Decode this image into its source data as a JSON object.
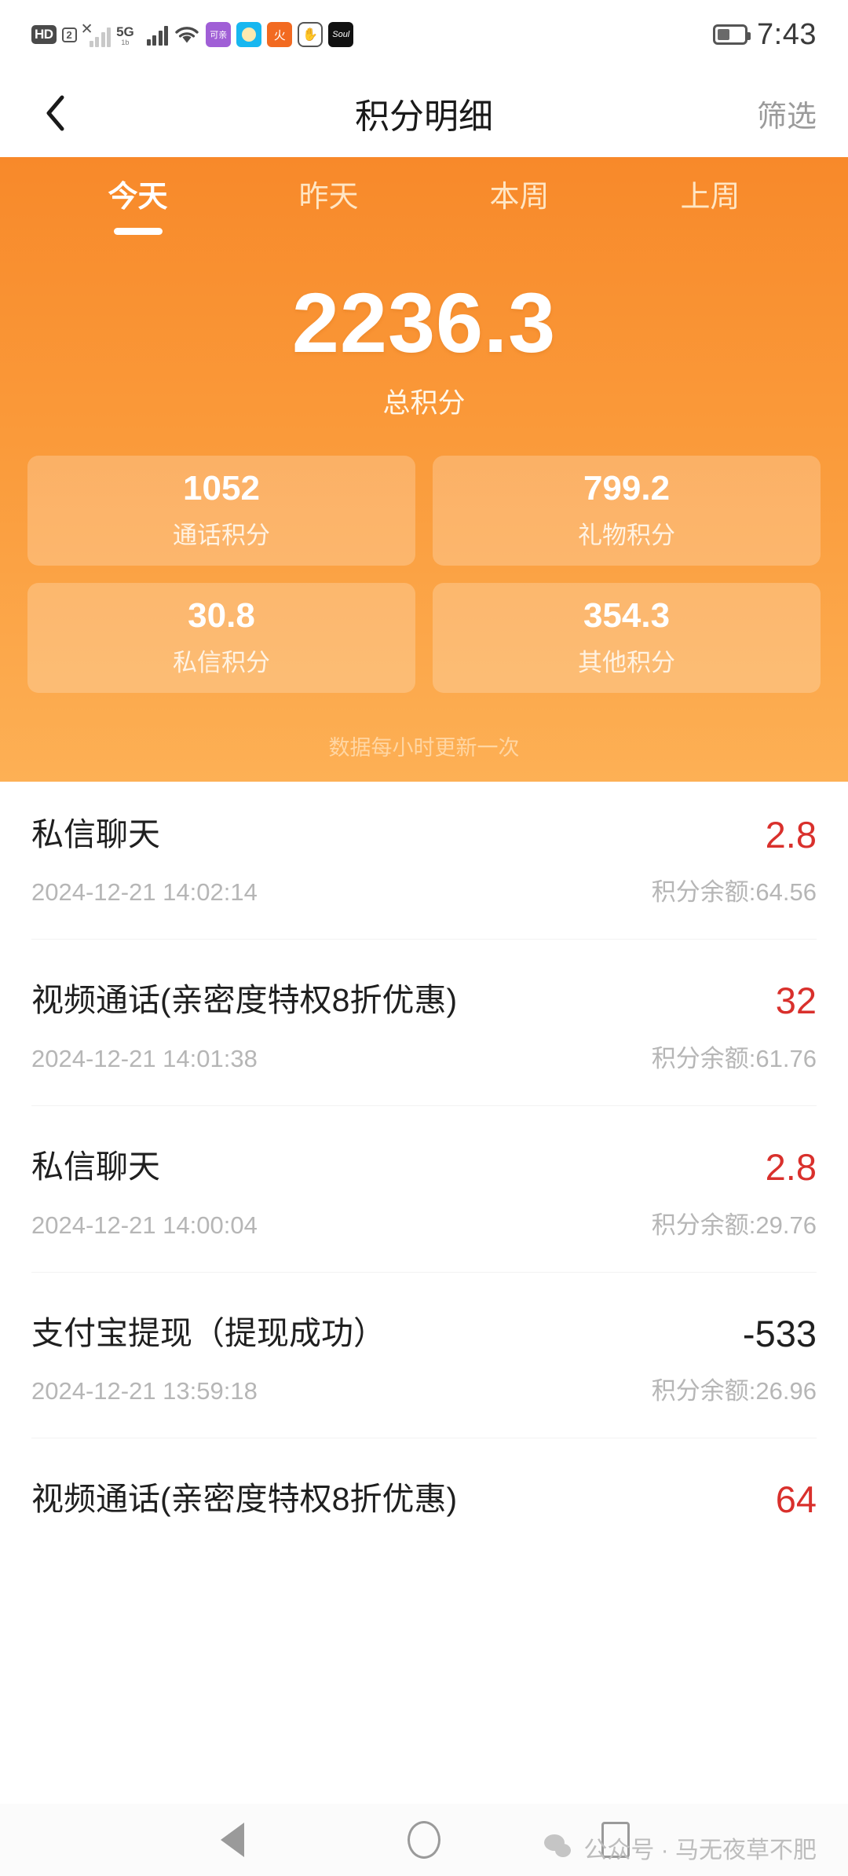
{
  "status_bar": {
    "hd_badge": "HD",
    "sim_badge": "2",
    "network_5g": "5G",
    "network_5g_sub": "1b",
    "app_icons": [
      {
        "name": "keqin-app-icon",
        "glyph": "可亲"
      },
      {
        "name": "blue-app-icon",
        "glyph": ""
      },
      {
        "name": "orange-flame-app-icon",
        "glyph": "火"
      },
      {
        "name": "hand-app-icon",
        "glyph": "✋"
      },
      {
        "name": "soul-app-icon",
        "glyph": "Soul"
      }
    ],
    "time": "7:43"
  },
  "navbar": {
    "back_icon": "chevron-left-icon",
    "title": "积分明细",
    "filter_label": "筛选"
  },
  "hero": {
    "tabs": [
      {
        "label": "今天",
        "active": true
      },
      {
        "label": "昨天",
        "active": false
      },
      {
        "label": "本周",
        "active": false
      },
      {
        "label": "上周",
        "active": false
      }
    ],
    "total_value": "2236.3",
    "total_label": "总积分",
    "stat_cards": [
      {
        "value": "1052",
        "label": "通话积分"
      },
      {
        "value": "799.2",
        "label": "礼物积分"
      },
      {
        "value": "30.8",
        "label": "私信积分"
      },
      {
        "value": "354.3",
        "label": "其他积分"
      }
    ],
    "note": "数据每小时更新一次",
    "gradient_start": "#F8892A",
    "gradient_end": "#FDB055",
    "card_bg": "rgba(255,255,255,0.22)"
  },
  "transactions": {
    "balance_prefix": "积分余额:",
    "positive_color": "#d9302c",
    "negative_color": "#1f1f1f",
    "items": [
      {
        "title": "私信聊天",
        "time": "2024-12-21 14:02:14",
        "amount": "2.8",
        "sign": "positive",
        "balance": "积分余额:64.56"
      },
      {
        "title": "视频通话(亲密度特权8折优惠)",
        "time": "2024-12-21 14:01:38",
        "amount": "32",
        "sign": "positive",
        "balance": "积分余额:61.76"
      },
      {
        "title": "私信聊天",
        "time": "2024-12-21 14:00:04",
        "amount": "2.8",
        "sign": "positive",
        "balance": "积分余额:29.76"
      },
      {
        "title": "支付宝提现（提现成功）",
        "time": "2024-12-21 13:59:18",
        "amount": "-533",
        "sign": "negative",
        "balance": "积分余额:26.96"
      },
      {
        "title": "视频通话(亲密度特权8折优惠)",
        "time": "",
        "amount": "64",
        "sign": "positive",
        "balance": ""
      }
    ]
  },
  "bottom_nav": {
    "back_icon": "triangle-back-icon",
    "home_icon": "circle-home-icon",
    "recents_icon": "square-recents-icon",
    "watermark": "公众号 · 马无夜草不肥"
  }
}
